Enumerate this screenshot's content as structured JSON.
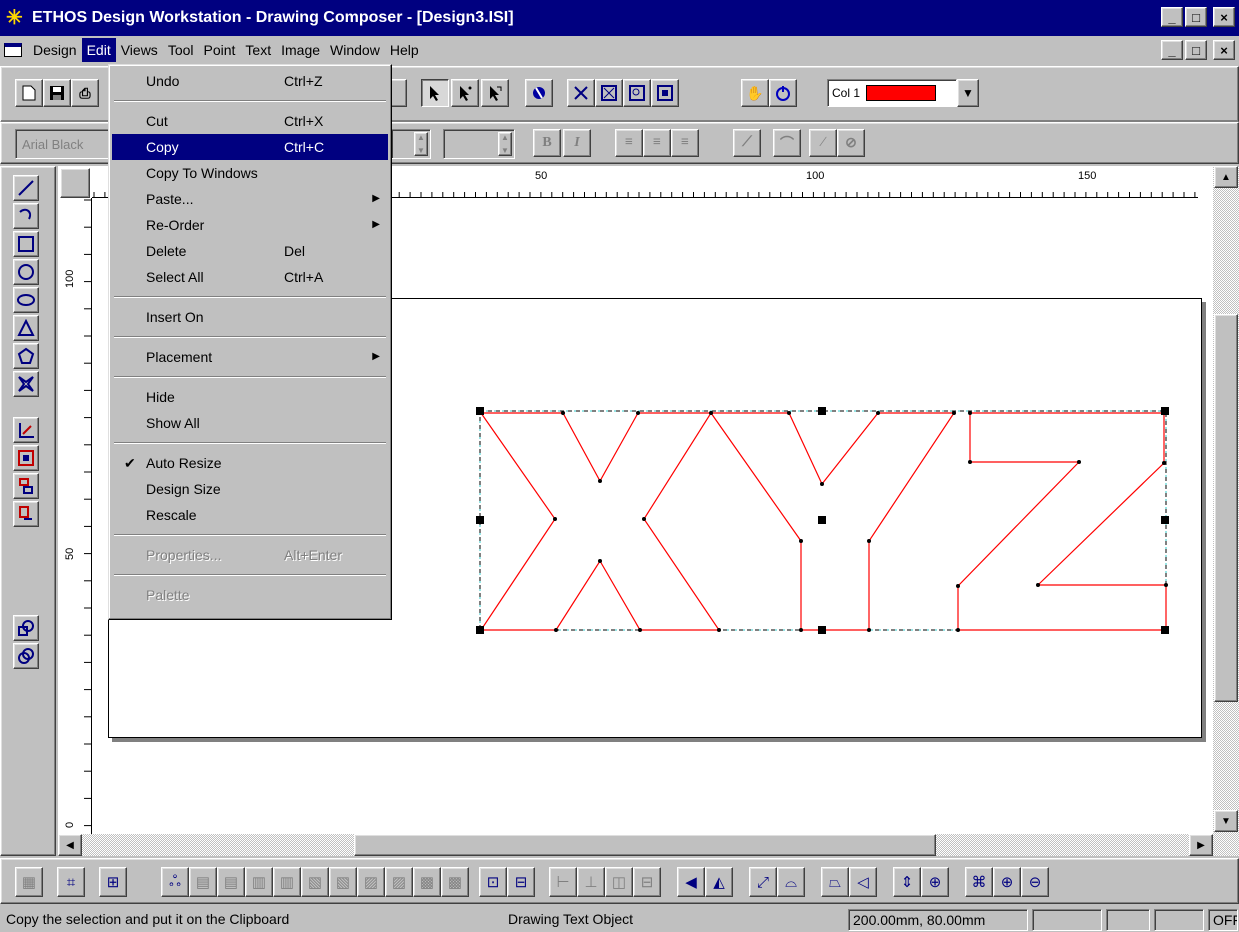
{
  "window": {
    "title": "ETHOS Design Workstation - Drawing Composer - [Design3.ISI]",
    "caption_buttons": [
      "_",
      "□",
      "×"
    ]
  },
  "menubar": {
    "items": [
      "Design",
      "Edit",
      "Views",
      "Tool",
      "Point",
      "Text",
      "Image",
      "Window",
      "Help"
    ],
    "active": "Edit"
  },
  "edit_menu": {
    "undo": {
      "label": "Undo",
      "shortcut": "Ctrl+Z"
    },
    "cut": {
      "label": "Cut",
      "shortcut": "Ctrl+X"
    },
    "copy": {
      "label": "Copy",
      "shortcut": "Ctrl+C"
    },
    "copy_to_windows": {
      "label": "Copy To Windows"
    },
    "paste": {
      "label": "Paste..."
    },
    "reorder": {
      "label": "Re-Order"
    },
    "delete": {
      "label": "Delete",
      "shortcut": "Del"
    },
    "select_all": {
      "label": "Select All",
      "shortcut": "Ctrl+A"
    },
    "insert_on": {
      "label": "Insert On"
    },
    "placement": {
      "label": "Placement"
    },
    "hide": {
      "label": "Hide"
    },
    "show_all": {
      "label": "Show All"
    },
    "auto_resize": {
      "label": "Auto Resize",
      "checked": true
    },
    "design_size": {
      "label": "Design Size"
    },
    "rescale": {
      "label": "Rescale"
    },
    "properties": {
      "label": "Properties...",
      "shortcut": "Alt+Enter",
      "disabled": true
    },
    "palette": {
      "label": "Palette",
      "disabled": true
    }
  },
  "toolbar": {
    "font_name": "Arial Black",
    "color_label": "Col 1",
    "color_value": "#ff0000"
  },
  "rulers": {
    "horizontal_labels": [
      "50",
      "100",
      "150"
    ],
    "vertical_labels": [
      "100",
      "50",
      "0"
    ]
  },
  "drawing": {
    "text": "XYZ",
    "stroke_color": "#ff0000"
  },
  "statusbar": {
    "message": "Copy the selection and put it on the Clipboard",
    "object_type": "Drawing Text Object",
    "size": "200.00mm, 80.00mm",
    "mode": "OFF"
  },
  "colors": {
    "title_bar": "#000080",
    "menu_highlight": "#000080",
    "face": "#c0c0c0"
  }
}
